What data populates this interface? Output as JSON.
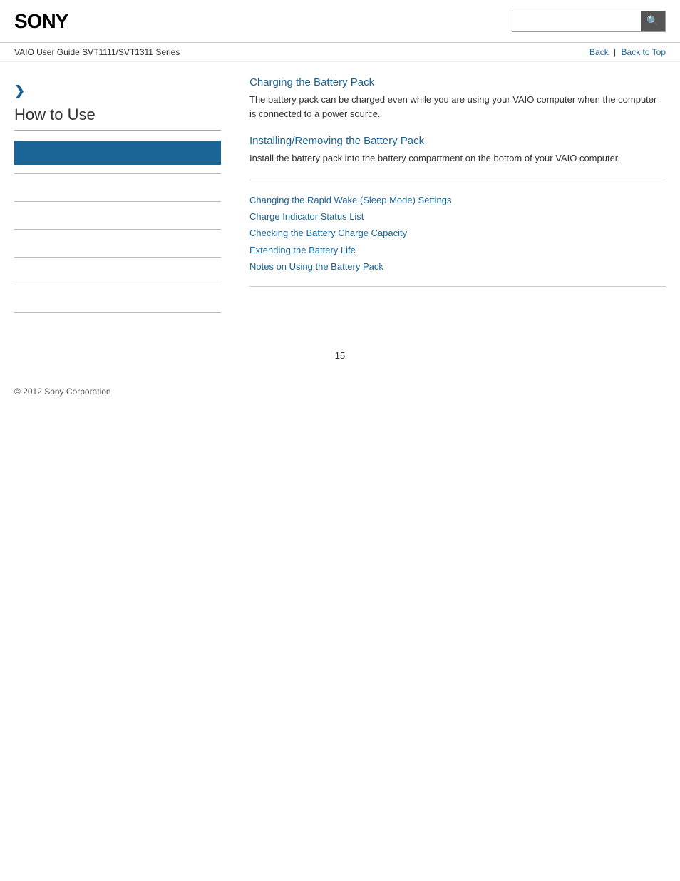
{
  "header": {
    "logo": "SONY",
    "search_placeholder": "",
    "search_icon": "🔍"
  },
  "subheader": {
    "guide_title": "VAIO User Guide SVT1111/SVT1311 Series",
    "back_label": "Back",
    "back_to_top_label": "Back to Top"
  },
  "sidebar": {
    "chevron": "❯",
    "title": "How to Use",
    "active_item_label": "",
    "dividers": 6
  },
  "content": {
    "section1": {
      "title": "Charging the Battery Pack",
      "description": "The battery pack can be charged even while you are using your VAIO computer when the computer is connected to a power source."
    },
    "section2": {
      "title": "Installing/Removing the Battery Pack",
      "description": "Install the battery pack into the battery compartment on the bottom of your VAIO computer."
    },
    "links": [
      {
        "label": "Changing the Rapid Wake (Sleep Mode) Settings"
      },
      {
        "label": "Charge Indicator Status List"
      },
      {
        "label": "Checking the Battery Charge Capacity"
      },
      {
        "label": "Extending the Battery Life"
      },
      {
        "label": "Notes on Using the Battery Pack"
      }
    ]
  },
  "footer": {
    "copyright": "© 2012 Sony Corporation",
    "page_number": "15"
  }
}
